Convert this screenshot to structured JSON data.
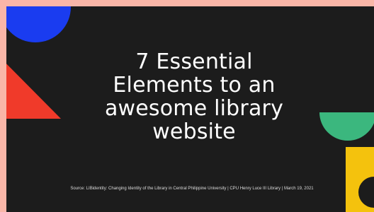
{
  "slide": {
    "title_lines": [
      "7 Essential",
      "Elements to an",
      "awesome library",
      "website"
    ],
    "source_text": "Source: LIBidentity: Changing Identity of the Library in Central Philippine University | CPU Henry Luce III Library | March 19, 2021"
  },
  "decor": {
    "blue_circle": "#1a3cf0",
    "red_triangle": "#f03a2a",
    "green_half_circle": "#3bb77e",
    "yellow_block": "#f4c20d",
    "background": "#1c1c1c",
    "border": "#f9b6a8"
  }
}
